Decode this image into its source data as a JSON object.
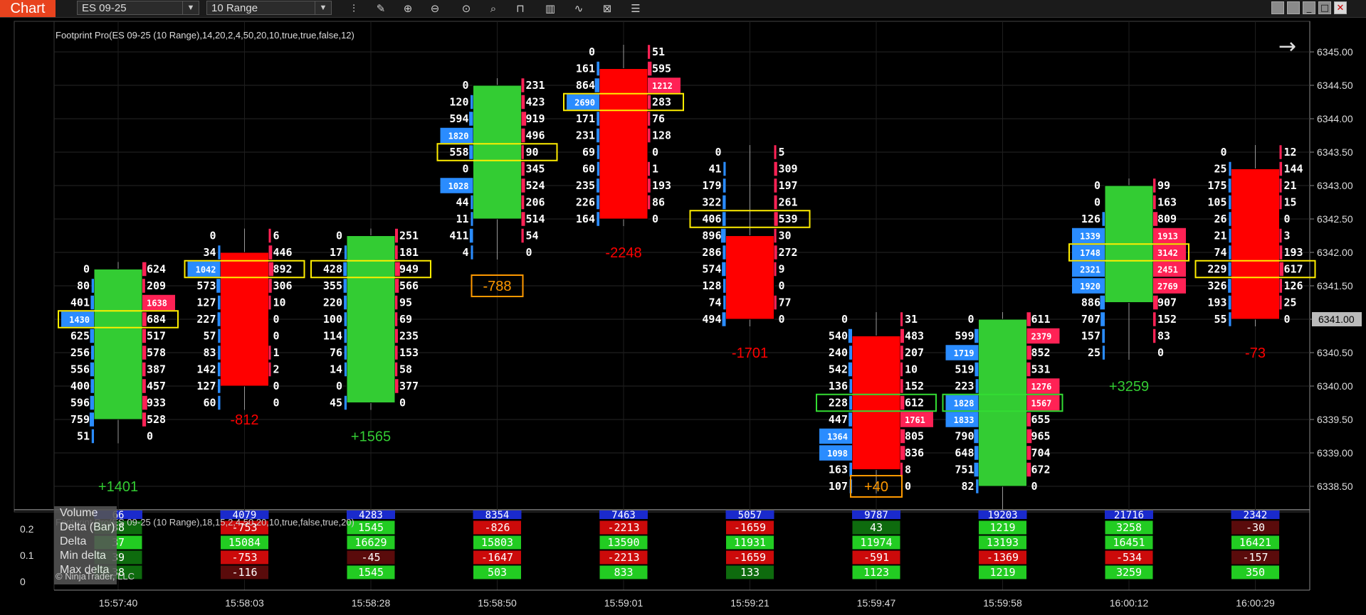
{
  "toolbar": {
    "chart_label": "Chart",
    "instrument": "ES 09-25",
    "bar_type": "10 Range",
    "icons": [
      "bar-style-icon",
      "draw-pencil-icon",
      "zoom-in-icon",
      "zoom-out-icon",
      "crosshair-icon",
      "data-box-icon",
      "instrument-icon",
      "indicators-icon",
      "strategies-icon",
      "properties-icon",
      "menu-list-icon"
    ]
  },
  "indicator_label": "Footprint Pro(ES 09-25 (10 Range),14,20,2,4,50,20,10,true,true,false,12)",
  "lower_label": "Footprint Pro(ES 09-25 (10 Range),18,15,2,4,50,20,10,true,false,true,20)",
  "copyright": "© NinjaTrader, LLC",
  "row_labels": [
    "Volume",
    "Delta (Bar)",
    "Delta",
    "Min delta",
    "Max delta"
  ],
  "lower_y_ticks": [
    "0.2",
    "0.1",
    "0"
  ],
  "colors": {
    "up": "#33cc33",
    "down": "#ff0000",
    "poc": "#ffee00",
    "bid": "#2a8cff",
    "ask": "#ff2255",
    "amber": "#ff9900"
  },
  "chart_data": {
    "type": "footprint",
    "y_ticks": [
      "6345.00",
      "6344.50",
      "6344.00",
      "6343.50",
      "6343.00",
      "6342.50",
      "6342.00",
      "6341.50",
      "6341.00",
      "6340.50",
      "6340.00",
      "6339.50",
      "6339.00",
      "6338.50"
    ],
    "current_price": "6341.00",
    "x_labels": [
      "15:57:40",
      "15:58:03",
      "15:58:28",
      "15:58:50",
      "15:59:01",
      "15:59:21",
      "15:59:47",
      "15:59:58",
      "16:00:12",
      "16:00:29"
    ],
    "bars": [
      {
        "dir": "up",
        "open": 6339.5,
        "close": 6341.75,
        "high": 6341.75,
        "low": 6339.25,
        "delta": "+1401",
        "dy": 6338.5,
        "poc_y": 6341.0,
        "bid": [
          "0",
          "80",
          "401",
          "1430",
          "625",
          "256",
          "556",
          "400",
          "596",
          "759",
          "51"
        ],
        "ask": [
          "624",
          "209",
          "1638",
          "684",
          "517",
          "578",
          "387",
          "457",
          "933",
          "528",
          "0"
        ]
      },
      {
        "dir": "down",
        "open": 6342.0,
        "close": 6340.0,
        "high": 6342.25,
        "low": 6339.75,
        "delta": "-812",
        "dy": 6339.5,
        "poc_y": 6341.75,
        "bid": [
          "0",
          "34",
          "1042",
          "573",
          "127",
          "227",
          "57",
          "83",
          "142",
          "127",
          "60"
        ],
        "ask": [
          "6",
          "446",
          "892",
          "306",
          "10",
          "0",
          "0",
          "1",
          "2",
          "0",
          "0"
        ]
      },
      {
        "dir": "up",
        "open": 6339.75,
        "close": 6342.25,
        "high": 6342.25,
        "low": 6339.75,
        "delta": "+1565",
        "dy": 6339.25,
        "poc_y": 6341.75,
        "bid": [
          "0",
          "17",
          "428",
          "355",
          "220",
          "100",
          "114",
          "76",
          "14",
          "0",
          "45"
        ],
        "ask": [
          "251",
          "181",
          "949",
          "566",
          "95",
          "69",
          "235",
          "153",
          "58",
          "377",
          "0"
        ]
      },
      {
        "dir": "up",
        "open": 6342.5,
        "close": 6344.5,
        "high": 6344.5,
        "low": 6342.0,
        "delta": "-788",
        "dy": 6341.5,
        "poc_y": 6343.5,
        "bid": [
          "0",
          "120",
          "594",
          "1820",
          "558",
          "0",
          "1028",
          "44",
          "11",
          "411",
          "4"
        ],
        "ask": [
          "231",
          "423",
          "919",
          "496",
          "90",
          "345",
          "524",
          "206",
          "514",
          "54",
          "0"
        ]
      },
      {
        "dir": "down",
        "open": 6344.75,
        "close": 6342.5,
        "high": 6345.0,
        "low": 6342.5,
        "delta": "-2248",
        "dy": 6342.0,
        "poc_y": 6344.25,
        "bid": [
          "0",
          "161",
          "864",
          "2690",
          "171",
          "231",
          "69",
          "60",
          "235",
          "226",
          "164"
        ],
        "ask": [
          "51",
          "595",
          "1212",
          "283",
          "76",
          "128",
          "0",
          "1",
          "193",
          "86",
          "0"
        ]
      },
      {
        "dir": "down",
        "open": 6342.25,
        "close": 6341.0,
        "high": 6343.5,
        "low": 6341.0,
        "delta": "-1701",
        "dy": 6340.5,
        "poc_y": 6342.5,
        "bid": [
          "0",
          "41",
          "179",
          "322",
          "406",
          "896",
          "286",
          "574",
          "128",
          "74",
          "494"
        ],
        "ask": [
          "5",
          "309",
          "197",
          "261",
          "539",
          "30",
          "272",
          "9",
          "0",
          "77",
          "0"
        ]
      },
      {
        "dir": "down",
        "open": 6340.75,
        "close": 6338.75,
        "high": 6341.0,
        "low": 6338.5,
        "delta": "+40",
        "dy": 6338.5,
        "poc_y": 6339.75,
        "bid": [
          "0",
          "540",
          "240",
          "542",
          "136",
          "228",
          "447",
          "1364",
          "1098",
          "163",
          "107"
        ],
        "ask": [
          "31",
          "483",
          "207",
          "10",
          "152",
          "612",
          "1761",
          "805",
          "836",
          "8",
          "0"
        ]
      },
      {
        "dir": "up",
        "open": 6338.5,
        "close": 6341.0,
        "high": 6341.0,
        "low": 6338.25,
        "delta": "",
        "dy": 6338.0,
        "poc_y": 6339.75,
        "bid": [
          "0",
          "599",
          "1719",
          "519",
          "223",
          "1828",
          "1833",
          "790",
          "648",
          "751",
          "82"
        ],
        "ask": [
          "611",
          "2379",
          "852",
          "531",
          "1276",
          "1567",
          "655",
          "965",
          "704",
          "672",
          "0"
        ]
      },
      {
        "dir": "up",
        "open": 6341.25,
        "close": 6343.0,
        "high": 6343.0,
        "low": 6340.5,
        "delta": "+3259",
        "dy": 6340.0,
        "poc_y": 6342.0,
        "bid": [
          "0",
          "0",
          "126",
          "1339",
          "1748",
          "2321",
          "1920",
          "886",
          "707",
          "157",
          "25"
        ],
        "ask": [
          "99",
          "163",
          "809",
          "1913",
          "3142",
          "2451",
          "2769",
          "907",
          "152",
          "83",
          "0"
        ]
      },
      {
        "dir": "down",
        "open": 6343.25,
        "close": 6341.0,
        "high": 6343.5,
        "low": 6341.0,
        "delta": "-73",
        "dy": 6340.5,
        "poc_y": 6341.75,
        "bid": [
          "0",
          "25",
          "175",
          "105",
          "26",
          "21",
          "74",
          "229",
          "326",
          "193",
          "55"
        ],
        "ask": [
          "12",
          "144",
          "21",
          "15",
          "0",
          "3",
          "193",
          "617",
          "126",
          "25",
          "0"
        ]
      }
    ],
    "table": {
      "volume": [
        "66",
        "4079",
        "4283",
        "8354",
        "7463",
        "5057",
        "9787",
        "",
        "19203",
        "21716",
        "2342"
      ],
      "delta_bar": [
        "38",
        "-753",
        "1545",
        "-826",
        "-2213",
        "-1659",
        "43",
        "1219",
        "3258",
        "-30"
      ],
      "delta": [
        "37",
        "15084",
        "16629",
        "15803",
        "13590",
        "11931",
        "11974",
        "13193",
        "16451",
        "16421"
      ],
      "min_delta": [
        "39",
        "-753",
        "-45",
        "-1647",
        "-2213",
        "-1659",
        "-591",
        "-1369",
        "-534",
        "-157"
      ],
      "max_delta": [
        "38",
        "-116",
        "1545",
        "503",
        "833",
        "133",
        "1123",
        "1219",
        "3259",
        "350"
      ]
    }
  }
}
